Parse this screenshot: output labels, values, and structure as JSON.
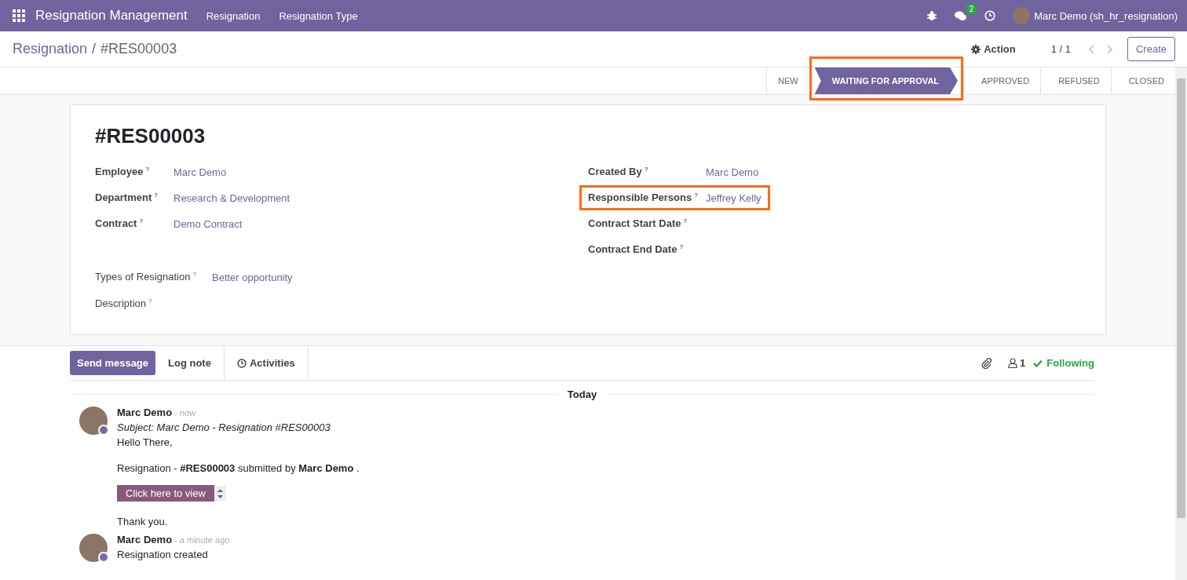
{
  "navbar": {
    "app_name": "Resignation Management",
    "menus": [
      "Resignation",
      "Resignation Type"
    ],
    "message_count": "2",
    "user": "Marc Demo (sh_hr_resignation)"
  },
  "control_panel": {
    "breadcrumb": "Resignation",
    "separator": "/",
    "record": "#RES00003",
    "action": "Action",
    "pager": "1 / 1",
    "create": "Create"
  },
  "statusbar": [
    {
      "label": "NEW",
      "selected": false,
      "highlighted": false
    },
    {
      "label": "WAITING FOR APPROVAL",
      "selected": true,
      "highlighted": true
    },
    {
      "label": "APPROVED",
      "selected": false,
      "highlighted": false
    },
    {
      "label": "REFUSED",
      "selected": false,
      "highlighted": false
    },
    {
      "label": "CLOSED",
      "selected": false,
      "highlighted": false
    }
  ],
  "form": {
    "title": "#RES00003",
    "help_mark": "?",
    "left_fields": [
      {
        "label": "Employee",
        "value": "Marc Demo"
      },
      {
        "label": "Department",
        "value": "Research & Development"
      },
      {
        "label": "Contract",
        "value": "Demo Contract"
      }
    ],
    "right_fields": [
      {
        "label": "Created By",
        "value": "Marc Demo",
        "highlighted": false
      },
      {
        "label": "Responsible Persons",
        "value": "Jeffrey Kelly",
        "highlighted": true
      },
      {
        "label": "Contract Start Date",
        "highlighted": false
      },
      {
        "label": "Contract End Date",
        "highlighted": false
      }
    ],
    "bottom_fields": [
      {
        "label": "Types of Resignation",
        "value": "Better opportunity"
      },
      {
        "label": "Description"
      }
    ]
  },
  "chatter": {
    "send_message": "Send message",
    "log_note": "Log note",
    "activities": "Activities",
    "followers": "1",
    "following": "Following",
    "date_separator": "Today",
    "messages": [
      {
        "author": "Marc Demo",
        "time": "- now",
        "subject": "Subject: Marc Demo - Resignation #RES00003",
        "paragraphs": [
          "Hello There,",
          "Resignation - **#RES00003** submitted by **Marc Demo** ."
        ],
        "button": "Click here to view",
        "closing": "Thank you."
      },
      {
        "author": "Marc Demo",
        "time": "- a minute ago",
        "paragraphs": [
          "Resignation created"
        ]
      }
    ]
  }
}
